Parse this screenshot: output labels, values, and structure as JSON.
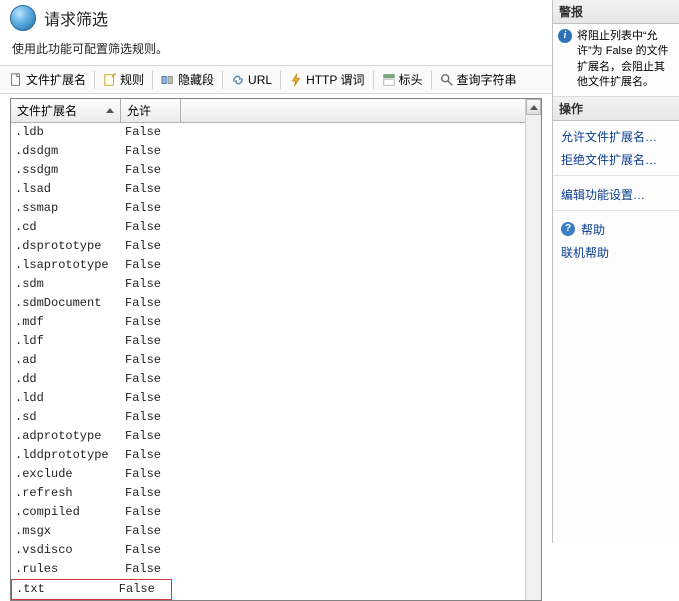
{
  "header": {
    "title": "请求筛选"
  },
  "subtitle": "使用此功能可配置筛选规则。",
  "toolbar": {
    "ext": "文件扩展名",
    "rules": "规则",
    "hidden": "隐藏段",
    "url": "URL",
    "http": "HTTP 谓词",
    "headers": "标头",
    "query": "查询字符串"
  },
  "columns": {
    "ext": "文件扩展名",
    "allow": "允许"
  },
  "rows": [
    {
      "ext": ".ldb",
      "allow": "False"
    },
    {
      "ext": ".dsdgm",
      "allow": "False"
    },
    {
      "ext": ".ssdgm",
      "allow": "False"
    },
    {
      "ext": ".lsad",
      "allow": "False"
    },
    {
      "ext": ".ssmap",
      "allow": "False"
    },
    {
      "ext": ".cd",
      "allow": "False"
    },
    {
      "ext": ".dsprototype",
      "allow": "False"
    },
    {
      "ext": ".lsaprototype",
      "allow": "False"
    },
    {
      "ext": ".sdm",
      "allow": "False"
    },
    {
      "ext": ".sdmDocument",
      "allow": "False"
    },
    {
      "ext": ".mdf",
      "allow": "False"
    },
    {
      "ext": ".ldf",
      "allow": "False"
    },
    {
      "ext": ".ad",
      "allow": "False"
    },
    {
      "ext": ".dd",
      "allow": "False"
    },
    {
      "ext": ".ldd",
      "allow": "False"
    },
    {
      "ext": ".sd",
      "allow": "False"
    },
    {
      "ext": ".adprototype",
      "allow": "False"
    },
    {
      "ext": ".lddprototype",
      "allow": "False"
    },
    {
      "ext": ".exclude",
      "allow": "False"
    },
    {
      "ext": ".refresh",
      "allow": "False"
    },
    {
      "ext": ".compiled",
      "allow": "False"
    },
    {
      "ext": ".msgx",
      "allow": "False"
    },
    {
      "ext": ".vsdisco",
      "allow": "False"
    },
    {
      "ext": ".rules",
      "allow": "False"
    },
    {
      "ext": ".txt",
      "allow": "False"
    }
  ],
  "highlighted_index": 24,
  "side": {
    "alerts_hdr": "警报",
    "alert_text": "将阻止列表中“允许”为 False 的文件扩展名，会阻止其他文件扩展名。",
    "actions_hdr": "操作",
    "actions": {
      "allow": "允许文件扩展名…",
      "deny": "拒绝文件扩展名…",
      "edit": "编辑功能设置…",
      "help": "帮助",
      "online": "联机帮助"
    }
  }
}
